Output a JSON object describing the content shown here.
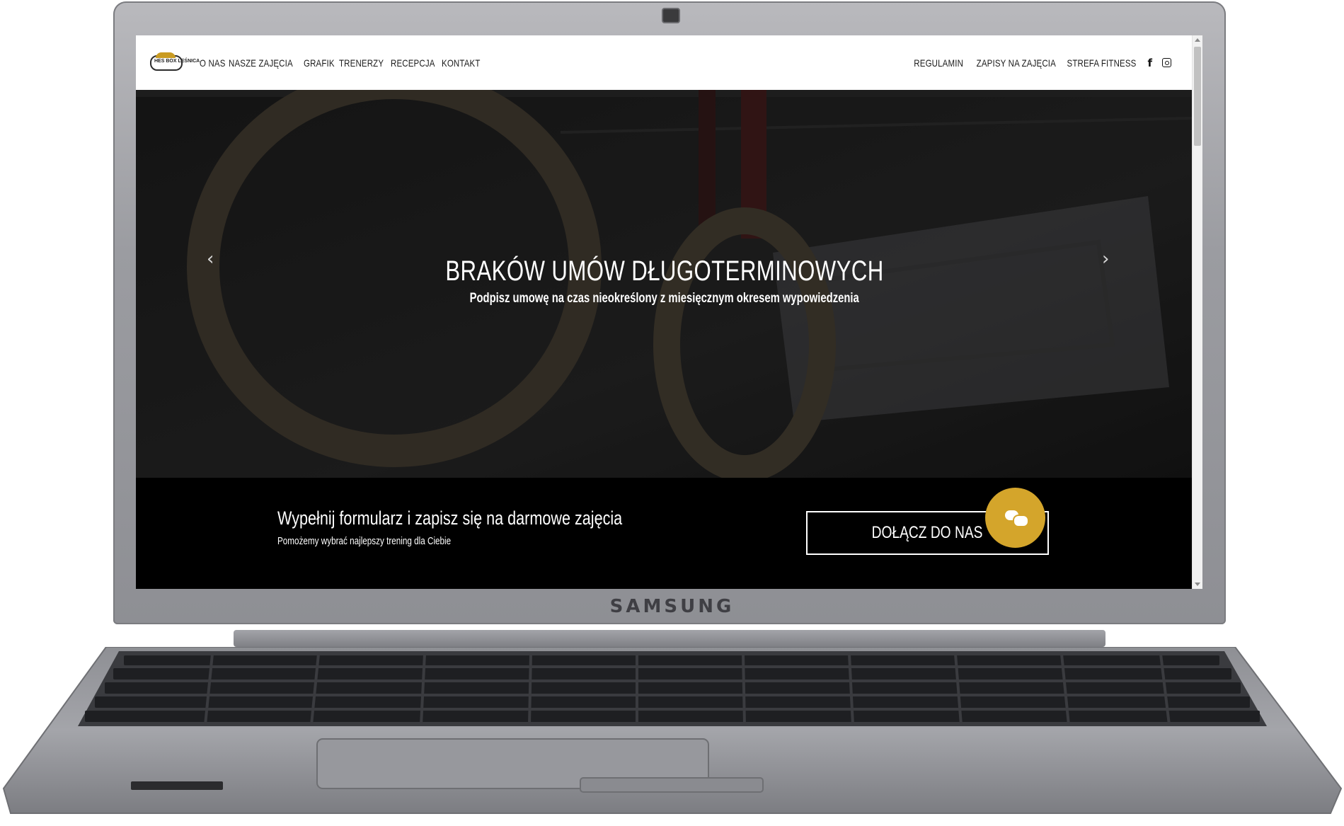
{
  "device": {
    "brand": "SAMSUNG"
  },
  "logo": {
    "text": "HES BOX LEŚNICA"
  },
  "nav": {
    "left_items": [
      "O NAS",
      "NASZE ZAJĘCIA",
      "GRAFIK",
      "TRENERZY",
      "RECEPCJA",
      "KONTAKT"
    ],
    "right_items": [
      "REGULAMIN",
      "ZAPISY NA ZAJĘCIA",
      "STREFA FITNESS"
    ],
    "social_icons": [
      "facebook-icon",
      "instagram-icon"
    ]
  },
  "hero": {
    "title": "BRAKÓW UMÓW DŁUGOTERMINOWYCH",
    "subtitle": "Podpisz umowę na czas nieokreślony z miesięcznym okresem wypowiedzenia",
    "prev_icon": "‹",
    "next_icon": "›"
  },
  "cta": {
    "title": "Wypełnij formularz i zapisz się na darmowe zajęcia",
    "subtitle": "Pomożemy wybrać najlepszy trening dla Ciebie",
    "button_label": "DOŁĄCZ DO NAS"
  },
  "colors": {
    "accent": "#d4a52b",
    "cta_background": "#000000",
    "hero_overlay": "#161616",
    "laptop_body": "#9b9ca1"
  }
}
